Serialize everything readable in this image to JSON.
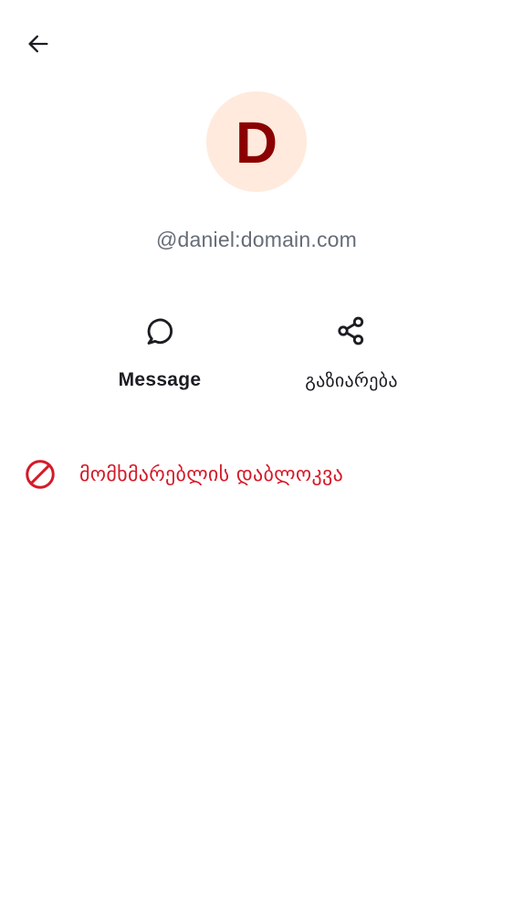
{
  "colors": {
    "text_primary": "#1b1d22",
    "text_secondary": "#656d77",
    "avatar_background": "#ffeadd",
    "avatar_letter": "#8b0000",
    "critical": "#d51928"
  },
  "header": {
    "back_icon": "arrow-left-icon"
  },
  "profile": {
    "avatar_letter": "D",
    "user_id": "@daniel:domain.com"
  },
  "actions": [
    {
      "icon": "chat-bubble-icon",
      "label": "Message"
    },
    {
      "icon": "share-icon",
      "label": "გაზიარება"
    }
  ],
  "block": {
    "icon": "block-icon",
    "label": "მომხმარებლის დაბლოკვა"
  }
}
